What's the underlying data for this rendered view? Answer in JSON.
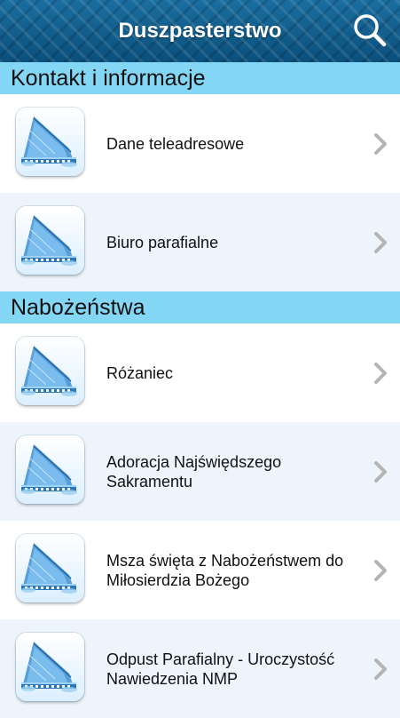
{
  "header": {
    "title": "Duszpasterstwo",
    "search_icon": "search-icon"
  },
  "sections": [
    {
      "title": "Kontakt i informacje",
      "items": [
        {
          "label": "Dane teleadresowe"
        },
        {
          "label": "Biuro parafialne"
        }
      ]
    },
    {
      "title": "Nabożeństwa",
      "items": [
        {
          "label": "Różaniec"
        },
        {
          "label": "Adoracja Najświędszego Sakramentu"
        },
        {
          "label": "Msza święta z Nabożeństwem do Miłosierdzia Bożego"
        },
        {
          "label": "Odpust Parafialny - Uroczystość Nawiedzenia NMP"
        }
      ]
    }
  ],
  "colors": {
    "app_bar": "#0d5a8a",
    "section_header": "#84d6f5",
    "row_alt": "#eef4fc",
    "chevron": "#b4b4b4"
  }
}
